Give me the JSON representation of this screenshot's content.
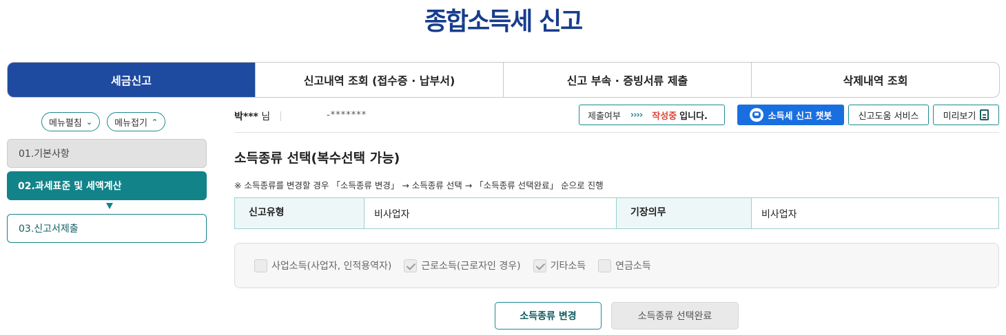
{
  "page": {
    "title": "종합소득세 신고"
  },
  "main_tabs": [
    {
      "label": "세금신고",
      "active": true
    },
    {
      "label": "신고내역 조회 (접수증 · 납부서)",
      "active": false
    },
    {
      "label": "신고 부속 · 증빙서류 제출",
      "active": false
    },
    {
      "label": "삭제내역 조회",
      "active": false
    }
  ],
  "menu_toggles": {
    "expand": "메뉴펼침",
    "collapse": "메뉴접기"
  },
  "steps": [
    {
      "label": "01.기본사항",
      "state": "done"
    },
    {
      "label": "02.과세표준 및 세액계산",
      "state": "current"
    },
    {
      "label": "03.신고서제출",
      "state": "pending"
    }
  ],
  "user": {
    "name": "박***",
    "suffix": " 님",
    "id_masked": "-*******"
  },
  "status": {
    "label": "제출여부",
    "arrows": "››››",
    "value": "작성중",
    "suffix": "입니다."
  },
  "buttons": {
    "chatbot": "소득세 신고 챗봇",
    "help": "신고도움 서비스",
    "preview": "미리보기",
    "change": "소득종류 변경",
    "done": "소득종류 선택완료"
  },
  "section": {
    "title": "소득종류 선택(복수선택 가능)",
    "notice": "※ 소득종류를 변경할 경우 「소득종류 변경」 → 소득종류 선택 → 「소득종류 선택완료」 순으로 진행"
  },
  "info_table": {
    "filing_type_label": "신고유형",
    "filing_type_value": "비사업자",
    "bookkeeping_label": "기장의무",
    "bookkeeping_value": "비사업자"
  },
  "income_types": [
    {
      "label": "사업소득(사업자, 인적용역자)",
      "checked": false
    },
    {
      "label": "근로소득(근로자인 경우)",
      "checked": true
    },
    {
      "label": "기타소득",
      "checked": true
    },
    {
      "label": "연금소득",
      "checked": false
    }
  ],
  "colors": {
    "title": "#173d8c",
    "tab_active": "#1e4aa0",
    "teal": "#128389",
    "status_red": "#e0443a",
    "chatbot_blue": "#1a6fe0"
  }
}
